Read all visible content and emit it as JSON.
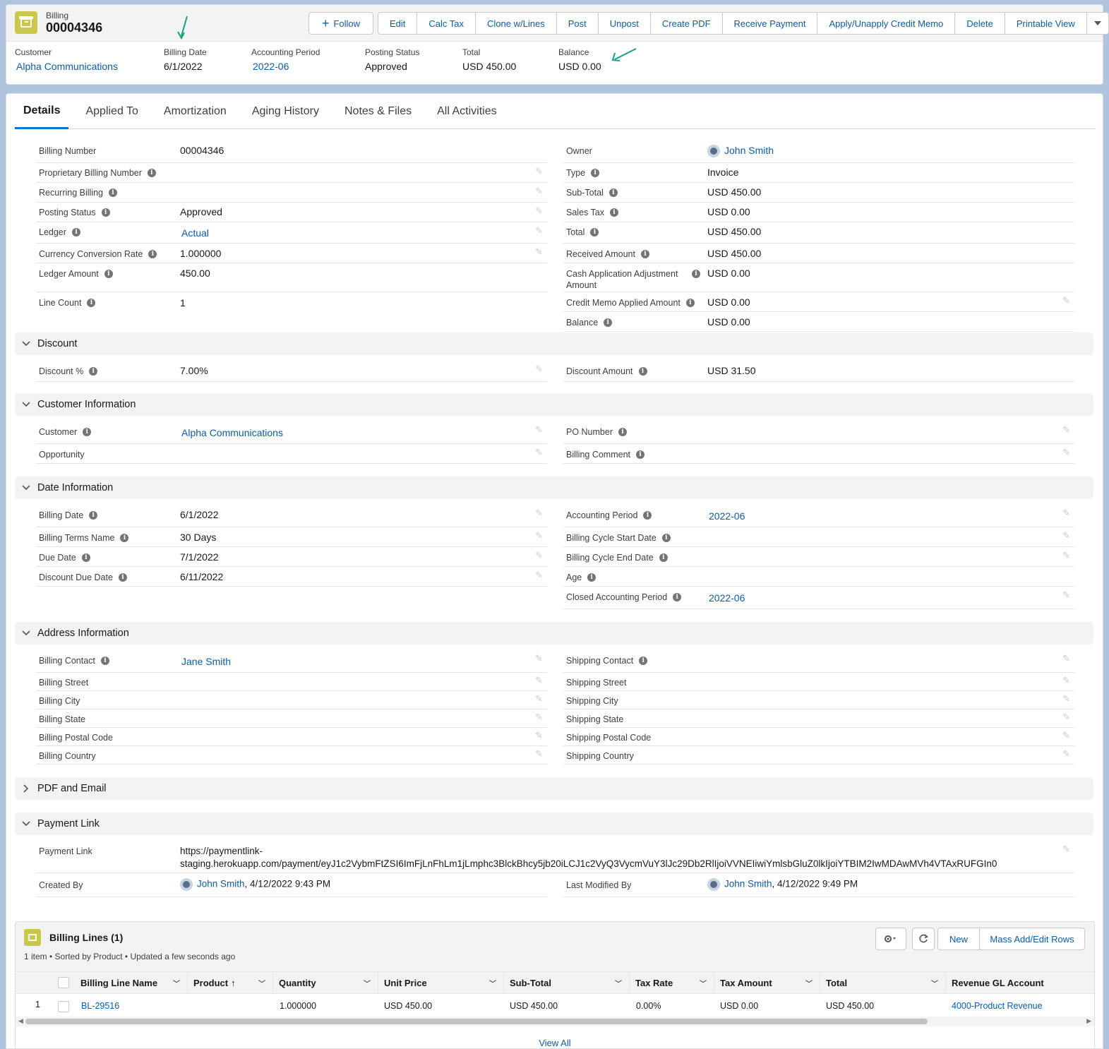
{
  "header": {
    "object_type": "Billing",
    "record_name": "00004346",
    "follow_label": "Follow",
    "actions": [
      "Edit",
      "Calc Tax",
      "Clone w/Lines",
      "Post",
      "Unpost",
      "Create PDF",
      "Receive Payment",
      "Apply/Unapply Credit Memo",
      "Delete",
      "Printable View"
    ],
    "highlights": {
      "customer_label": "Customer",
      "customer_value": "Alpha Communications",
      "billing_date_label": "Billing Date",
      "billing_date_value": "6/1/2022",
      "accounting_period_label": "Accounting Period",
      "accounting_period_value": "2022-06",
      "posting_status_label": "Posting Status",
      "posting_status_value": "Approved",
      "total_label": "Total",
      "total_value": "USD 450.00",
      "balance_label": "Balance",
      "balance_value": "USD 0.00"
    },
    "arrow_color": "#14a085"
  },
  "tabs": [
    "Details",
    "Applied To",
    "Amortization",
    "Aging History",
    "Notes & Files",
    "All Activities"
  ],
  "details": {
    "left": [
      {
        "label": "Billing Number",
        "value": "00004346",
        "info": false
      },
      {
        "label": "Proprietary Billing Number",
        "value": "",
        "info": true
      },
      {
        "label": "Recurring Billing",
        "value": "",
        "info": true
      },
      {
        "label": "Posting Status",
        "value": "Approved",
        "info": true
      },
      {
        "label": "Ledger",
        "value": "Actual",
        "info": true
      },
      {
        "label": "Currency Conversion Rate",
        "value": "1.000000",
        "info": true
      },
      {
        "label": "Ledger Amount",
        "value": "450.00",
        "info": true
      },
      {
        "label": "Line Count",
        "value": "1",
        "info": true
      }
    ],
    "right": [
      {
        "label": "Owner",
        "value": "John Smith"
      },
      {
        "label": "Type",
        "value": "Invoice"
      },
      {
        "label": "Sub-Total",
        "value": "USD 450.00"
      },
      {
        "label": "Sales Tax",
        "value": "USD 0.00"
      },
      {
        "label": "Total",
        "value": "USD 450.00"
      },
      {
        "label": "Received Amount",
        "value": "USD 450.00"
      },
      {
        "label": "Cash Application Adjustment Amount",
        "label_line1": "Cash Application Adjustment",
        "label_line2": "Amount",
        "value": "USD 0.00"
      },
      {
        "label": "Credit Memo Applied Amount",
        "value": "USD 0.00"
      },
      {
        "label": "Balance",
        "value": "USD 0.00"
      }
    ]
  },
  "sections": {
    "discount": {
      "title": "Discount",
      "discount_pct_label": "Discount %",
      "discount_pct_value": "7.00%",
      "discount_amount_label": "Discount Amount",
      "discount_amount_value": "USD 31.50"
    },
    "customer_info": {
      "title": "Customer Information",
      "customer_label": "Customer",
      "customer_value": "Alpha Communications",
      "opportunity_label": "Opportunity",
      "po_label": "PO Number",
      "comment_label": "Billing Comment"
    },
    "date_info": {
      "title": "Date Information",
      "left": [
        {
          "label": "Billing Date",
          "value": "6/1/2022"
        },
        {
          "label": "Billing Terms Name",
          "value": "30 Days"
        },
        {
          "label": "Due Date",
          "value": "7/1/2022"
        },
        {
          "label": "Discount Due Date",
          "value": "6/11/2022"
        }
      ],
      "right": [
        {
          "label": "Accounting Period",
          "value": "2022-06"
        },
        {
          "label": "Billing Cycle Start Date",
          "value": ""
        },
        {
          "label": "Billing Cycle End Date",
          "value": ""
        },
        {
          "label": "Age",
          "value": ""
        },
        {
          "label": "Closed Accounting Period",
          "value": "2022-06"
        }
      ]
    },
    "address_info": {
      "title": "Address Information",
      "left": [
        "Billing Contact",
        "Billing Street",
        "Billing City",
        "Billing State",
        "Billing Postal Code",
        "Billing Country"
      ],
      "billing_contact_value": "Jane Smith",
      "right": [
        "Shipping Contact",
        "Shipping Street",
        "Shipping City",
        "Shipping State",
        "Shipping Postal Code",
        "Shipping Country"
      ]
    },
    "pdf_email": {
      "title": "PDF and Email"
    },
    "payment_link": {
      "title": "Payment Link",
      "label": "Payment Link",
      "value_line1": "https://paymentlink-",
      "value_line2": "staging.herokuapp.com/payment/eyJ1c2VybmFtZSI6ImFjLnFhLm1jLmphc3BlckBhcy5jb20iLCJ1c2VyQ3VycmVuY3lJc29Db2RlIjoiVVNEIiwiYmlsbGluZ0lkIjoiYTBIM2IwMDAwMVh4VTAxRUFGIn0",
      "created_by_label": "Created By",
      "created_by_user": "John Smith",
      "created_by_date": ", 4/12/2022 9:43 PM",
      "modified_by_label": "Last Modified By",
      "modified_by_user": "John Smith",
      "modified_by_date": ", 4/12/2022 9:49 PM"
    }
  },
  "billing_lines": {
    "title": "Billing Lines (1)",
    "subtitle": "1 item • Sorted by Product • Updated a few seconds ago",
    "new_label": "New",
    "mass_label": "Mass Add/Edit Rows",
    "columns": [
      "Billing Line Name",
      "Product",
      "Quantity",
      "Unit Price",
      "Sub-Total",
      "Tax Rate",
      "Tax Amount",
      "Total",
      "Revenue GL Account"
    ],
    "product_sort_indicator": "↑",
    "rows": [
      {
        "num": "1",
        "name": "BL-29516",
        "product": "",
        "quantity": "1.000000",
        "unit_price": "USD 450.00",
        "sub_total": "USD 450.00",
        "tax_rate": "0.00%",
        "tax_amount": "USD 0.00",
        "total": "USD 450.00",
        "gl_account": "4000-Product Revenue"
      }
    ],
    "view_all": "View All"
  }
}
